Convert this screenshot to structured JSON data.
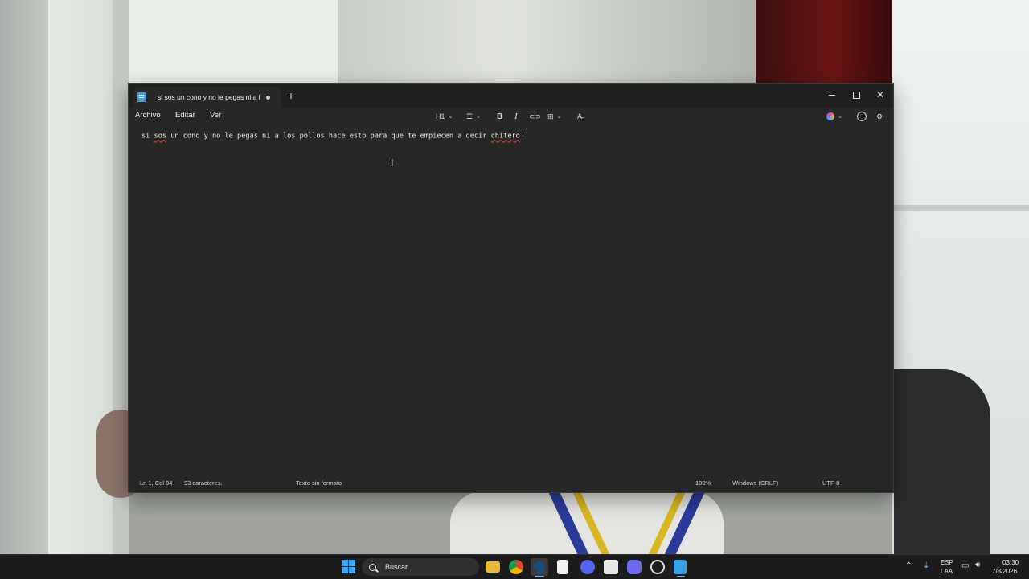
{
  "window": {
    "tab_title": "si sos un cono y no le pegas ni a l",
    "new_tab": "+",
    "controls": {
      "close": "✕"
    }
  },
  "menu": {
    "file": "Archivo",
    "edit": "Editar",
    "view": "Ver"
  },
  "toolbar": {
    "heading": "H1"
  },
  "editor": {
    "text_before": "si ",
    "misspelled_1": "sos",
    "text_middle": " un cono y no le pegas ni a los pollos hace esto para que te empiecen a decir ",
    "misspelled_2": "chitero"
  },
  "statusbar": {
    "position": "Ln 1, Col 94",
    "chars": "93 caracteres.",
    "format": "Texto sin formato",
    "zoom": "100%",
    "line_ending": "Windows (CRLF)",
    "encoding": "UTF-8"
  },
  "taskbar": {
    "search_placeholder": "Buscar",
    "lang_top": "ESP",
    "lang_bottom": "LAA",
    "time": "03:30",
    "date": "7/3/2026"
  },
  "colors": {
    "accent": "#3fa9ff",
    "spell_error": "#e04848",
    "editor_bg": "#272727"
  }
}
